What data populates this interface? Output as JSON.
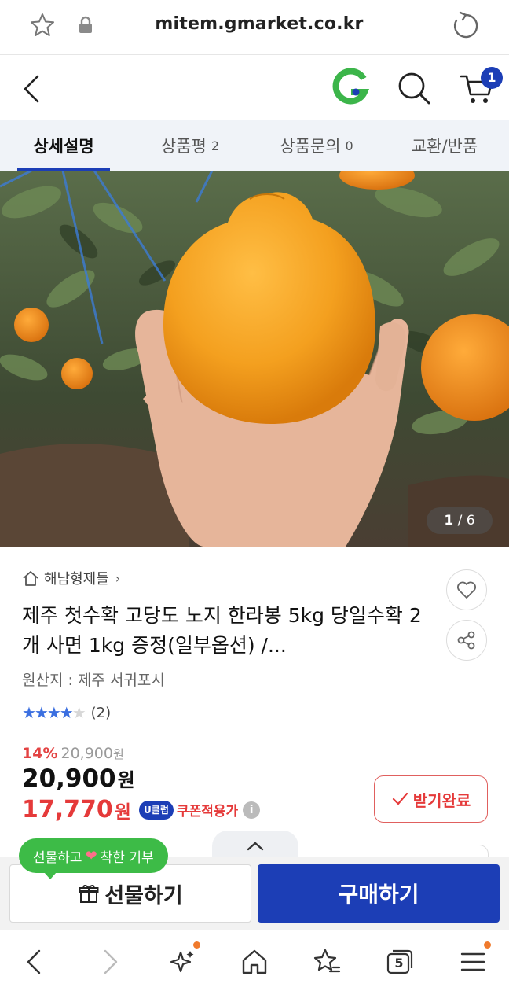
{
  "browser": {
    "url": "mitem.gmarket.co.kr"
  },
  "header": {
    "cart_count": "1"
  },
  "tabs": [
    {
      "label": "상세설명",
      "count": ""
    },
    {
      "label": "상품평",
      "count": "2"
    },
    {
      "label": "상품문의",
      "count": "0"
    },
    {
      "label": "교환/반품",
      "count": ""
    }
  ],
  "gallery": {
    "current": "1",
    "separator": "/",
    "total": "6"
  },
  "product": {
    "seller": "해남형제들",
    "title": "제주 첫수확 고당도 노지 한라봉 5kg 당일수확 2개 사면 1kg 증정(일부옵션) /...",
    "origin": "원산지 : 제주 서귀포시",
    "rating": {
      "stars": 4,
      "max": 5,
      "review_count": "(2)"
    },
    "discount_pct": "14%",
    "original_price": "20,900",
    "original_unit": "원",
    "price": "20,900",
    "price_unit": "원",
    "coupon_price": "17,770",
    "coupon_unit": "원",
    "uclub_badge": "U클럽",
    "coupon_label": "쿠폰적용가",
    "info_icon": "i",
    "received_button": "받기완료"
  },
  "purchase": {
    "gift_bubble_left": "선물하고",
    "gift_bubble_right": "착한 기부",
    "gift_button": "선물하기",
    "buy_button": "구매하기"
  },
  "browser_nav": {
    "tabs_count": "5"
  },
  "colors": {
    "brand_blue": "#1c3eb6",
    "sale_red": "#e53a3a",
    "gift_green": "#3dbb47",
    "star_blue": "#3b6fe0"
  }
}
